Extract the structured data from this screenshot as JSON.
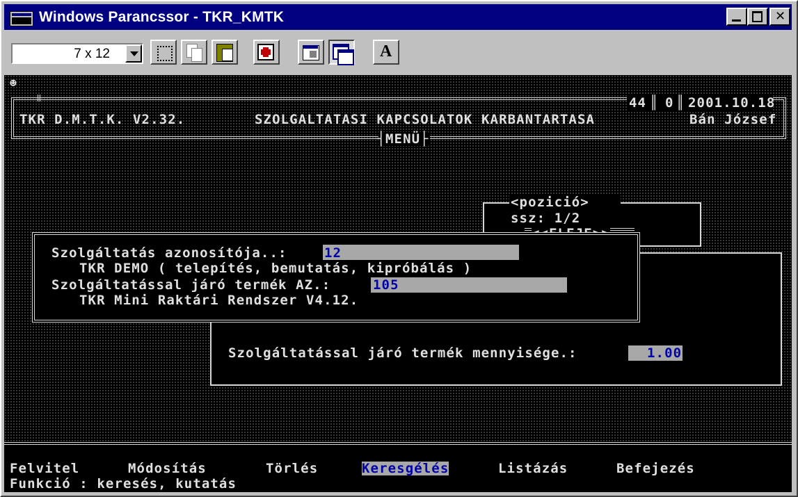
{
  "window": {
    "title": "Windows Parancssor - TKR_KMTK"
  },
  "toolbar": {
    "font_size": "7 x 12",
    "buttons": [
      {
        "name": "mark",
        "icon": "select-rect-icon"
      },
      {
        "name": "copy",
        "icon": "copy-icon"
      },
      {
        "name": "paste",
        "icon": "paste-icon"
      },
      {
        "name": "fullscreen",
        "icon": "fullscreen-icon"
      },
      {
        "name": "properties",
        "icon": "properties-icon"
      },
      {
        "name": "background",
        "icon": "background-icon"
      },
      {
        "name": "font",
        "icon": "font-icon",
        "label": "A"
      }
    ]
  },
  "console": {
    "smiley": "☻",
    "header": {
      "program": "TKR D.M.T.K. V2.32.",
      "module": "SZOLGALTATASI KAPCSOLATOK KARBANTARTASA",
      "record_no": "44",
      "zero": "0",
      "date": "2001.10.18",
      "user": "Bán József",
      "menu_label": "MENÜ"
    },
    "position_panel": {
      "title": "<pozició>",
      "ssz": "ssz: 1/2",
      "eleje": "<<ELEJE>>"
    },
    "form": {
      "service_id_label": "Szolgáltatás azonosítója..:",
      "service_id_value": "12",
      "service_name": "TKR DEMO ( telepítés, bemutatás, kipróbálás )",
      "product_id_label": "Szolgáltatással járó termék AZ.:",
      "product_id_value": "105",
      "product_name": "TKR Mini Raktári Rendszer V4.12.",
      "quantity_label": "Szolgáltatással járó termék mennyisége.:",
      "quantity_value": "1.00"
    },
    "menu": {
      "items": [
        "Felvitel",
        "Módosítás",
        "Törlés",
        "Keresgélés",
        "Listázás",
        "Befejezés"
      ],
      "selected": "Keresgélés",
      "function_line": "Funkció : keresés, kutatás"
    }
  }
}
